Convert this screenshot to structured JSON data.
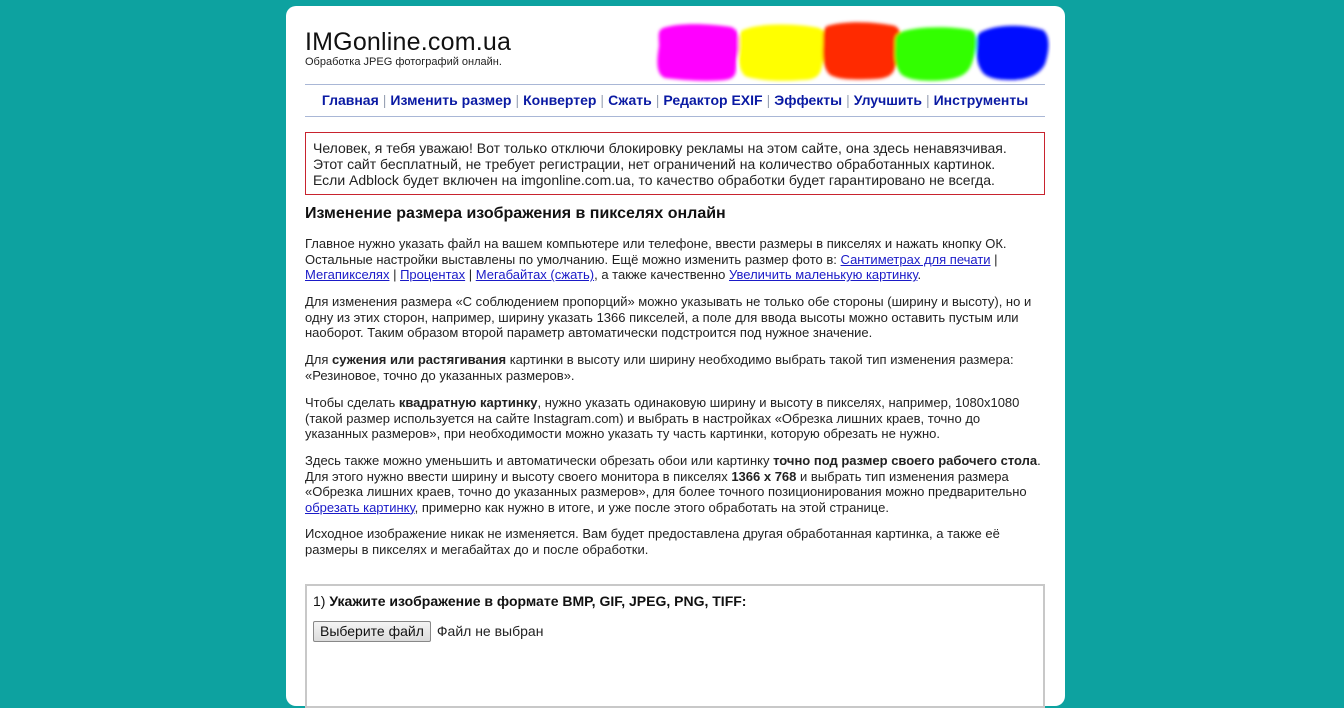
{
  "header": {
    "site_title": "IMGonline.com.ua",
    "tagline": "Обработка JPEG фотографий онлайн.",
    "blob_colors": [
      "#ff00ff",
      "#ffff00",
      "#ff2a00",
      "#33ff00",
      "#0011ff"
    ]
  },
  "nav": {
    "items": [
      {
        "label": "Главная"
      },
      {
        "label": "Изменить размер"
      },
      {
        "label": "Конвертер"
      },
      {
        "label": "Сжать"
      },
      {
        "label": "Редактор EXIF"
      },
      {
        "label": "Эффекты"
      },
      {
        "label": "Улучшить"
      },
      {
        "label": "Инструменты"
      }
    ],
    "separator": "|"
  },
  "notice": {
    "line1": "Человек, я тебя уважаю! Вот только отключи блокировку рекламы на этом сайте, она здесь ненавязчивая.",
    "line2": "Этот сайт бесплатный, не требует регистрации, нет ограничений на количество обработанных картинок.",
    "line3": "Если Adblock будет включен на imgonline.com.ua, то качество обработки будет гарантировано не всегда."
  },
  "main": {
    "title": "Изменение размера изображения в пикселях онлайн",
    "p1": {
      "text_a": "Главное нужно указать файл на вашем компьютере или телефоне, ввести размеры в пикселях и нажать кнопку ОК. Остальные настройки выставлены по умолчанию. Ещё можно изменить размер фото в: ",
      "link_cm": "Сантиметрах для печати",
      "sep": " | ",
      "link_mp": "Мегапикселях",
      "link_pct": "Процентах",
      "link_mb": "Мегабайтах (сжать)",
      "text_b": ", а также качественно ",
      "link_upscale": "Увеличить маленькую картинку",
      "text_c": "."
    },
    "p2": "Для изменения размера «С соблюдением пропорций» можно указывать не только обе стороны (ширину и высоту), но и одну из этих сторон, например, ширину указать 1366 пикселей, а поле для ввода высоты можно оставить пустым или наоборот. Таким образом второй параметр автоматически подстроится под нужное значение.",
    "p3": {
      "text_a": "Для ",
      "bold": "сужения или растягивания",
      "text_b": " картинки в высоту или ширину необходимо выбрать такой тип изменения размера: «Резиновое, точно до указанных размеров»."
    },
    "p4": {
      "text_a": "Чтобы сделать ",
      "bold": "квадратную картинку",
      "text_b": ", нужно указать одинаковую ширину и высоту в пикселях, например, 1080х1080 (такой размер используется на сайте Instagram.com) и выбрать в настройках «Обрезка лишних краев, точно до указанных размеров», при необходимости можно указать ту часть картинки, которую обрезать не нужно."
    },
    "p5": {
      "text_a": "Здесь также можно уменьшить и автоматически обрезать обои или картинку ",
      "bold_a": "точно под размер своего рабочего стола",
      "text_b": ". Для этого нужно ввести ширину и высоту своего монитора в пикселях ",
      "bold_b": "1366 x 768",
      "text_c": " и выбрать тип изменения размера «Обрезка лишних краев, точно до указанных размеров», для более точного позиционирования можно предварительно ",
      "link_crop": "обрезать картинку",
      "text_d": ", примерно как нужно в итоге, и уже после этого обработать на этой странице."
    },
    "p6": "Исходное изображение никак не изменяется. Вам будет предоставлена другая обработанная картинка, а также её размеры в пикселях и мегабайтах до и после обработки."
  },
  "form": {
    "step_prefix": "1) ",
    "step_label": "Укажите изображение в формате BMP, GIF, JPEG, PNG, TIFF:",
    "file_button": "Выберите файл",
    "file_status": "Файл не выбран"
  }
}
